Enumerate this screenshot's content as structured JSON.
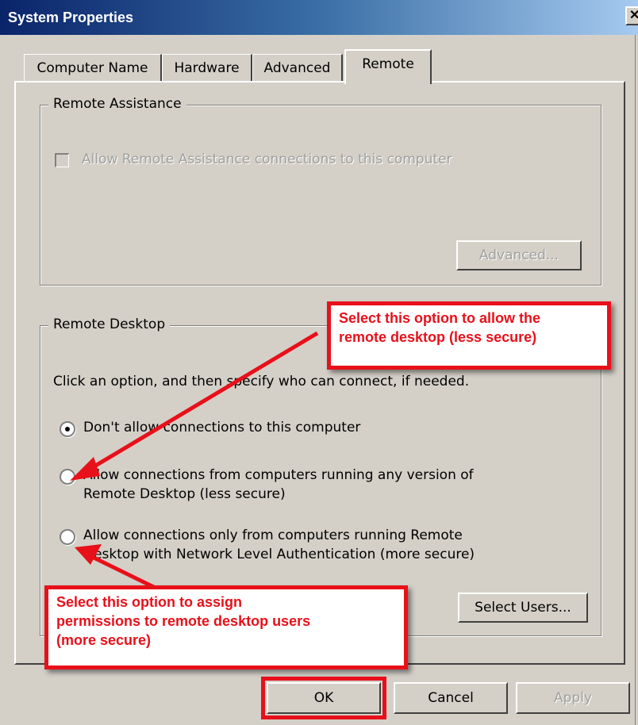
{
  "window": {
    "title": "System Properties",
    "close_glyph": "✕"
  },
  "tabs": [
    {
      "label": "Computer Name",
      "active": false
    },
    {
      "label": "Hardware",
      "active": false
    },
    {
      "label": "Advanced",
      "active": false
    },
    {
      "label": "Remote",
      "active": true
    }
  ],
  "remote_assistance": {
    "legend": "Remote Assistance",
    "checkbox_label": "Allow Remote Assistance connections to this computer",
    "checked": false,
    "enabled": false,
    "advanced_button": "Advanced..."
  },
  "remote_desktop": {
    "legend": "Remote Desktop",
    "instruction": "Click an option, and then specify who can connect, if needed.",
    "options": [
      {
        "lines": [
          "Don't allow connections to this computer"
        ],
        "selected": true
      },
      {
        "lines": [
          "Allow connections from computers running any version of",
          "Remote Desktop (less secure)"
        ],
        "selected": false
      },
      {
        "lines": [
          "Allow connections only from computers running Remote",
          "Desktop with Network Level Authentication (more secure)"
        ],
        "selected": false
      }
    ],
    "select_users_button": "Select Users..."
  },
  "buttons": {
    "ok": "OK",
    "cancel": "Cancel",
    "apply": "Apply"
  },
  "annotations": {
    "top_callout": [
      "Select this option to allow the",
      "remote desktop (less secure)"
    ],
    "bottom_callout": [
      "Select this option to assign",
      "permissions to remote desktop users",
      "(more secure)"
    ],
    "color": "#e8101a"
  }
}
